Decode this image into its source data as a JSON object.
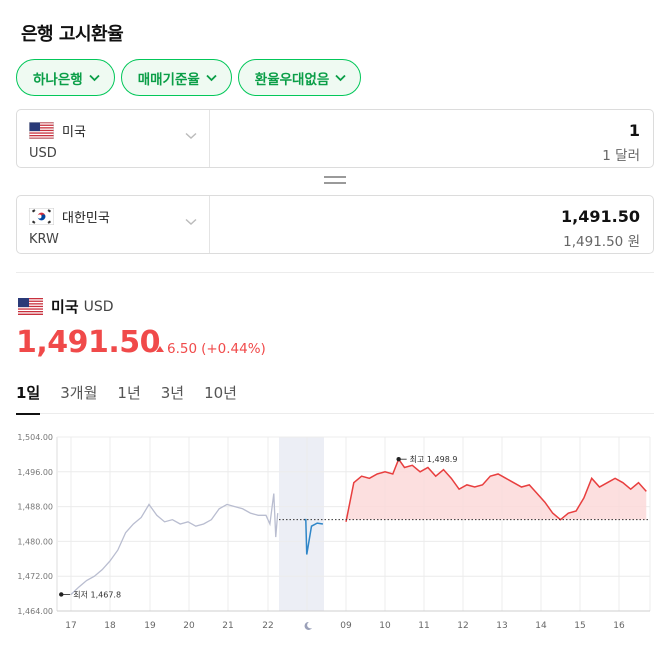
{
  "title": "은행 고시환율",
  "filters": [
    {
      "label": "하나은행"
    },
    {
      "label": "매매기준율"
    },
    {
      "label": "환율우대없음"
    }
  ],
  "converter": {
    "from": {
      "country": "미국",
      "code": "USD",
      "amount": "1",
      "amount_text": "1 달러",
      "flag": "us-flag-icon"
    },
    "to": {
      "country": "대한민국",
      "code": "KRW",
      "amount": "1,491.50",
      "amount_text": "1,491.50 원",
      "flag": "kr-flag-icon"
    }
  },
  "summary": {
    "country": "미국",
    "code": "USD",
    "rate": "1,491.50",
    "change": "6.50",
    "change_pct": "(+0.44%)",
    "direction": "up"
  },
  "tabs": [
    {
      "label": "1일",
      "active": true
    },
    {
      "label": "3개월",
      "active": false
    },
    {
      "label": "1년",
      "active": false
    },
    {
      "label": "3년",
      "active": false
    },
    {
      "label": "10년",
      "active": false
    }
  ],
  "colors": {
    "accent_green": "#03c75a",
    "up_red": "#f04a4a",
    "line_red": "#e83f3f",
    "fill_red": "#fbd9d9",
    "overnight_blue": "#2f86c8",
    "pre_gray": "#b9bdd0",
    "closed_band": "#eceef5"
  },
  "chart_data": {
    "type": "line",
    "ylim": [
      1464,
      1504
    ],
    "y_ticks": [
      "1,504.00",
      "1,496.00",
      "1,488.00",
      "1,480.00",
      "1,472.00",
      "1,464.00"
    ],
    "x_tick_labels": [
      "17",
      "18",
      "19",
      "20",
      "21",
      "22",
      "moon-icon",
      "09",
      "10",
      "11",
      "12",
      "13",
      "14",
      "15",
      "16"
    ],
    "reference_value": 1485.0,
    "annotations": {
      "high": {
        "label": "최고 1,498.9",
        "value": 1498.9
      },
      "low": {
        "label": "최저 1,467.8",
        "value": 1467.8
      }
    },
    "series": [
      {
        "segment": "previous",
        "x": [
          17.0,
          17.2,
          17.4,
          17.6,
          17.8,
          18.0,
          18.2,
          18.4,
          18.6,
          18.8,
          19.0,
          19.2,
          19.4,
          19.6,
          19.8,
          20.0,
          20.2,
          20.4,
          20.6,
          20.8,
          21.0,
          21.2,
          21.4,
          21.6,
          21.8,
          22.0,
          22.1,
          22.2,
          22.25,
          22.3
        ],
        "y": [
          1467.8,
          1469.5,
          1471.0,
          1472.0,
          1473.5,
          1475.5,
          1478.0,
          1482.0,
          1484.0,
          1485.5,
          1488.5,
          1486.0,
          1484.5,
          1485.0,
          1484.0,
          1484.5,
          1483.5,
          1484.0,
          1485.0,
          1487.5,
          1488.5,
          1488.0,
          1487.5,
          1486.5,
          1486.0,
          1486.0,
          1484.0,
          1491.0,
          1481.0,
          1486.5
        ]
      },
      {
        "segment": "overnight",
        "x": [
          22.9,
          23.0,
          23.05,
          23.3,
          23.6,
          23.9
        ],
        "y": [
          1485.0,
          1485.0,
          1477.0,
          1483.5,
          1484.2,
          1484.0
        ]
      },
      {
        "segment": "today",
        "x": [
          9.0,
          9.2,
          9.4,
          9.6,
          9.8,
          10.0,
          10.2,
          10.35,
          10.5,
          10.7,
          10.9,
          11.1,
          11.3,
          11.5,
          11.7,
          11.9,
          12.1,
          12.3,
          12.5,
          12.7,
          12.9,
          13.1,
          13.3,
          13.5,
          13.7,
          13.9,
          14.1,
          14.3,
          14.5,
          14.7,
          14.9,
          15.1,
          15.3,
          15.5,
          15.7,
          15.9,
          16.1,
          16.3,
          16.5,
          16.7
        ],
        "y": [
          1484.5,
          1493.5,
          1495.0,
          1494.5,
          1495.5,
          1496.0,
          1495.5,
          1498.9,
          1497.0,
          1497.5,
          1496.0,
          1497.0,
          1495.0,
          1496.5,
          1494.5,
          1492.0,
          1493.0,
          1492.5,
          1493.0,
          1495.0,
          1495.5,
          1494.5,
          1493.5,
          1492.5,
          1493.0,
          1491.0,
          1489.0,
          1486.5,
          1485.0,
          1486.5,
          1487.0,
          1490.0,
          1494.5,
          1492.5,
          1493.5,
          1494.5,
          1493.5,
          1492.0,
          1493.5,
          1491.5
        ]
      }
    ]
  }
}
